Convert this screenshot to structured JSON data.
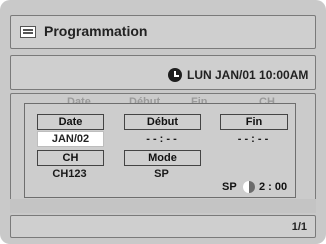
{
  "header": {
    "title": "Programmation",
    "icon": "list-icon"
  },
  "clock": {
    "icon": "clock-icon",
    "datetime": "LUN JAN/01 10:00AM"
  },
  "list": {
    "columns": [
      "Date",
      "Début",
      "Fin",
      "CH"
    ]
  },
  "dialog": {
    "date_label": "Date",
    "date_value": "JAN/02",
    "start_label": "Début",
    "start_value": "- - : - -",
    "end_label": "Fin",
    "end_value": "- - : - -",
    "ch_label": "CH",
    "ch_value": "CH123",
    "mode_label": "Mode",
    "mode_value": "SP",
    "remaining_mode": "SP",
    "remaining_time": "2 : 00",
    "disc_icon": "disc-icon"
  },
  "footer": {
    "page": "1/1"
  }
}
